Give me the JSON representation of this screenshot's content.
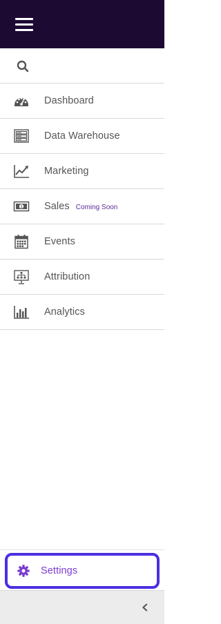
{
  "topbar": {
    "menu_icon": "hamburger-icon",
    "bg_color": "#1c0a33"
  },
  "search": {
    "icon": "search-icon",
    "placeholder": ""
  },
  "nav": {
    "items": [
      {
        "id": "dashboard",
        "label": "Dashboard",
        "icon": "dashboard-gauge-icon"
      },
      {
        "id": "data-warehouse",
        "label": "Data Warehouse",
        "icon": "server-rack-icon"
      },
      {
        "id": "marketing",
        "label": "Marketing",
        "icon": "trend-chart-icon"
      },
      {
        "id": "sales",
        "label": "Sales",
        "icon": "money-bill-icon",
        "badge": "Coming Soon"
      },
      {
        "id": "events",
        "label": "Events",
        "icon": "calendar-icon"
      },
      {
        "id": "attribution",
        "label": "Attribution",
        "icon": "presentation-flow-icon"
      },
      {
        "id": "analytics",
        "label": "Analytics",
        "icon": "bar-chart-icon"
      }
    ]
  },
  "settings": {
    "label": "Settings",
    "icon": "gear-icon",
    "accent_color": "#7a3bd0",
    "highlight_color": "#4b2fe0"
  },
  "footer": {
    "collapse_icon": "chevron-left-icon"
  }
}
